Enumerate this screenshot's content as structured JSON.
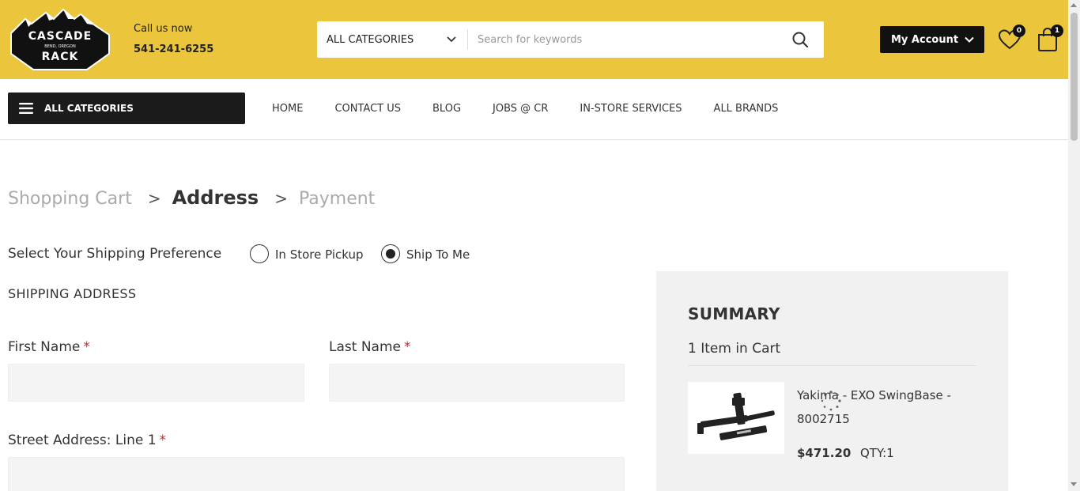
{
  "header": {
    "logo_text_top": "CASCADE",
    "logo_text_sub": "BEND, OREGON",
    "logo_text_bottom": "RACK",
    "call_label": "Call us now",
    "phone": "541-241-6255",
    "category_select": "ALL CATEGORIES",
    "search_placeholder": "Search for keywords",
    "account_label": "My Account",
    "wishlist_count": "0",
    "cart_count": "1",
    "accent_color": "#ebc53c"
  },
  "nav": {
    "all_categories": "ALL CATEGORIES",
    "items": [
      "HOME",
      "CONTACT US",
      "BLOG",
      "JOBS @ CR",
      "IN-STORE SERVICES",
      "ALL BRANDS"
    ]
  },
  "steps": {
    "cart": "Shopping Cart",
    "sep1": ">",
    "address": "Address",
    "sep2": ">",
    "payment": "Payment"
  },
  "shipping": {
    "preference_label": "Select Your Shipping Preference",
    "option_pickup": "In Store Pickup",
    "option_ship": "Ship To Me",
    "selected": "Ship To Me",
    "heading": "SHIPPING ADDRESS",
    "first_name_label": "First Name",
    "last_name_label": "Last Name",
    "street_label": "Street Address: Line 1",
    "required_mark": "*",
    "first_name_value": "",
    "last_name_value": "",
    "street_value": ""
  },
  "summary": {
    "title": "SUMMARY",
    "item_count": "1 Item in Cart",
    "product": {
      "name": "Yakima - EXO SwingBase - 8002715",
      "price": "$471.20",
      "qty": "QTY:1"
    }
  }
}
